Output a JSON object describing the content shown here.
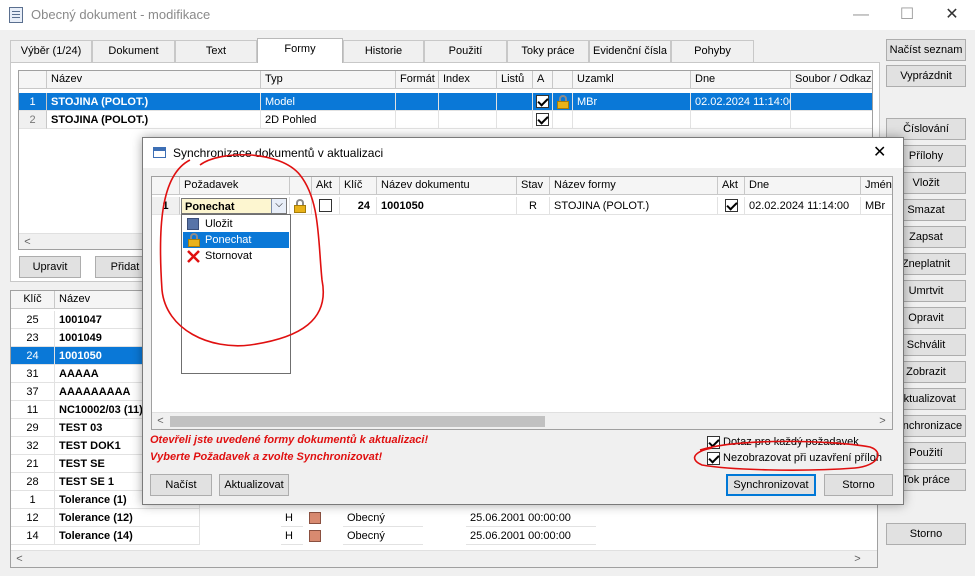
{
  "window": {
    "title": "Obecný dokument - modifikace",
    "minimize": "—",
    "maximize": "☐",
    "close": "✕"
  },
  "tabs": [
    "Výběr (1/24)",
    "Dokument",
    "Text",
    "Formy",
    "Historie",
    "Použití",
    "Toky práce",
    "Evidenční čísla",
    "Pohyby"
  ],
  "top_grid": {
    "headers": [
      "Název",
      "Typ",
      "Formát",
      "Index",
      "Listů",
      "A",
      "Uzamkl",
      "Dne",
      "Soubor / Odkaz"
    ],
    "rows": [
      {
        "n": "1",
        "name": "STOJINA (POLOT.)",
        "type": "Model",
        "user": "MBr",
        "date": "02.02.2024 11:14:00"
      },
      {
        "n": "2",
        "name": "STOJINA (POLOT.)",
        "type": "2D Pohled",
        "user": "",
        "date": ""
      }
    ]
  },
  "left_buttons": {
    "edit": "Upravit",
    "add": "Přidat"
  },
  "bottom_grid": {
    "headers": [
      "Klíč",
      "Název"
    ],
    "rows": [
      {
        "key": "25",
        "name": "1001047"
      },
      {
        "key": "23",
        "name": "1001049"
      },
      {
        "key": "24",
        "name": "1001050"
      },
      {
        "key": "31",
        "name": "AAAAA"
      },
      {
        "key": "37",
        "name": "AAAAAAAAA"
      },
      {
        "key": "11",
        "name": "NC10002/03 (11)"
      },
      {
        "key": "29",
        "name": "TEST 03"
      },
      {
        "key": "32",
        "name": "TEST DOK1"
      },
      {
        "key": "21",
        "name": "TEST SE"
      },
      {
        "key": "28",
        "name": "TEST SE 1"
      },
      {
        "key": "1",
        "name": "Tolerance (1)"
      },
      {
        "key": "12",
        "name": "Tolerance (12)",
        "h": "H",
        "kind": "Obecný",
        "date": "25.06.2001 00:00:00"
      },
      {
        "key": "14",
        "name": "Tolerance (14)",
        "h": "H",
        "kind": "Obecný",
        "date": "25.06.2001 00:00:00"
      }
    ]
  },
  "side_buttons": [
    "Načíst seznam",
    "Vyprázdnit",
    "Číslování",
    "Přílohy",
    "Vložit",
    "Smazat",
    "Zapsat",
    "Zneplatnit",
    "Umrtvit",
    "Opravit",
    "Schválit",
    "Zobrazit",
    "Aktualizovat",
    "Synchronizace",
    "Použití",
    "Tok práce",
    "Storno"
  ],
  "dialog": {
    "title": "Synchronizace dokumentů v aktualizaci",
    "close": "✕",
    "headers": [
      "Požadavek",
      "Akt",
      "Klíč",
      "Název dokumentu",
      "Stav",
      "Název formy",
      "Akt",
      "Dne",
      "Jméno"
    ],
    "row": {
      "n": "1",
      "request": "Ponechat",
      "key": "24",
      "doc": "1001050",
      "state": "R",
      "form": "STOJINA (POLOT.)",
      "date": "02.02.2024 11:14:00",
      "user": "MBr"
    },
    "dropdown_options": [
      "Uložit",
      "Ponechat",
      "Stornovat"
    ],
    "message_line1": "Otevřeli jste uvedené formy dokumentů k aktualizaci!",
    "message_line2": "Vyberte Požadavek a zvolte Synchronizovat!",
    "check_ask": "Dotaz pro každý požadavek",
    "check_hide": "Nezobrazovat při uzavření příloh",
    "btn_load": "Načíst",
    "btn_update": "Aktualizovat",
    "btn_sync": "Synchronizovat",
    "btn_cancel": "Storno"
  },
  "colors": {
    "selection": "#0a78d7",
    "annotation": "#e01010",
    "message": "#e01010"
  }
}
